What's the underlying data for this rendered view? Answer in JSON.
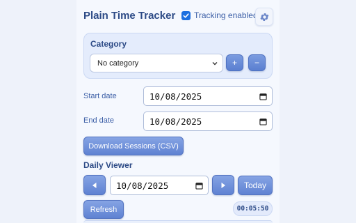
{
  "header": {
    "title": "Plain Time Tracker",
    "tracking_label": "Tracking enabled",
    "tracking_enabled": true,
    "settings_icon": "gear-icon"
  },
  "category": {
    "title": "Category",
    "selected": "No category",
    "add_label": "+",
    "remove_label": "−"
  },
  "range": {
    "start_label": "Start date",
    "start_value": "10/08/2025",
    "end_label": "End date",
    "end_value": "10/08/2025",
    "download_label": "Download Sessions (CSV)"
  },
  "daily": {
    "title": "Daily Viewer",
    "date_value": "10/08/2025",
    "today_label": "Today",
    "refresh_label": "Refresh",
    "timer": "00:05:50"
  },
  "colors": {
    "accent": "#5f82d2",
    "title": "#2c4a86",
    "panel": "#f5f8fe"
  }
}
